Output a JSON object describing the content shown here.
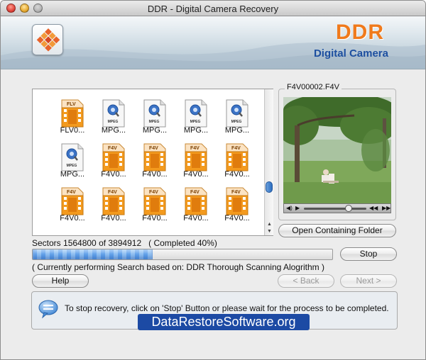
{
  "window": {
    "title": "DDR - Digital Camera Recovery"
  },
  "banner": {
    "brand": "DDR",
    "subtitle": "Digital Camera"
  },
  "files": [
    {
      "label": "FLV0...",
      "type": "flv"
    },
    {
      "label": "MPG...",
      "type": "mpeg"
    },
    {
      "label": "MPG...",
      "type": "mpeg"
    },
    {
      "label": "MPG...",
      "type": "mpeg"
    },
    {
      "label": "MPG...",
      "type": "mpeg"
    },
    {
      "label": "MPG...",
      "type": "mpeg"
    },
    {
      "label": "F4V0...",
      "type": "f4v"
    },
    {
      "label": "F4V0...",
      "type": "f4v"
    },
    {
      "label": "F4V0...",
      "type": "f4v"
    },
    {
      "label": "F4V0...",
      "type": "f4v"
    },
    {
      "label": "F4V0...",
      "type": "f4v"
    },
    {
      "label": "F4V0...",
      "type": "f4v"
    },
    {
      "label": "F4V0...",
      "type": "f4v"
    },
    {
      "label": "F4V0...",
      "type": "f4v"
    },
    {
      "label": "F4V0...",
      "type": "f4v"
    }
  ],
  "icon_text": {
    "flv": "FLV",
    "f4v": "F4V",
    "mpeg": "MPEG"
  },
  "preview": {
    "filename": "F4V00002.F4V",
    "open_folder_label": "Open Containing Folder"
  },
  "progress": {
    "sectors_text": "Sectors 1564800 of 3894912",
    "completed_text": "( Completed 40%)",
    "fraction": 0.4,
    "stop_label": "Stop",
    "status_text": "( Currently performing Search based on: DDR Thorough Scanning Alogrithm )"
  },
  "nav": {
    "help_label": "Help",
    "back_label": "< Back",
    "next_label": "Next >"
  },
  "info": {
    "message": "To stop recovery, click on 'Stop' Button or please wait for the process to be completed.",
    "watermark": "DataRestoreSoftware.org"
  },
  "colors": {
    "accent_orange": "#f07a1c",
    "progress_blue": "#5fa0ea",
    "watermark_bg": "#1c4aa4"
  }
}
